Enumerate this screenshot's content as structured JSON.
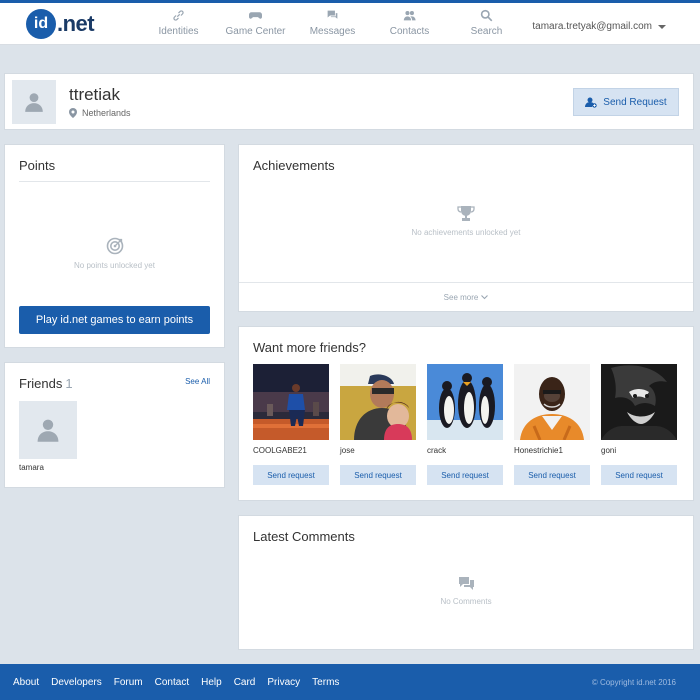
{
  "brand": {
    "logo_mark": "id",
    "logo_text": ".net",
    "color": "#1a5dab"
  },
  "nav": [
    {
      "label": "Identities",
      "icon": "link-icon"
    },
    {
      "label": "Game Center",
      "icon": "gamepad-icon"
    },
    {
      "label": "Messages",
      "icon": "chat-icon"
    },
    {
      "label": "Contacts",
      "icon": "users-icon"
    },
    {
      "label": "Search",
      "icon": "search-icon"
    }
  ],
  "user": {
    "email": "tamara.tretyak@gmail.com"
  },
  "profile": {
    "name": "ttretiak",
    "location": "Netherlands",
    "send_request_label": "Send Request"
  },
  "points": {
    "title": "Points",
    "empty_text": "No points unlocked yet",
    "play_button": "Play id.net games to earn points"
  },
  "friends": {
    "title": "Friends",
    "count": "1",
    "see_all": "See All",
    "items": [
      {
        "name": "tamara"
      }
    ]
  },
  "achievements": {
    "title": "Achievements",
    "empty_text": "No achievements unlocked yet",
    "see_more": "See more"
  },
  "want_more": {
    "title": "Want more friends?",
    "people": [
      {
        "name": "COOLGABE21",
        "button": "Send request"
      },
      {
        "name": "jose",
        "button": "Send request"
      },
      {
        "name": "crack",
        "button": "Send request"
      },
      {
        "name": "Honestrichie1",
        "button": "Send request"
      },
      {
        "name": "goni",
        "button": "Send request"
      }
    ]
  },
  "comments": {
    "title": "Latest Comments",
    "empty_text": "No Comments"
  },
  "footer": {
    "links": [
      "About",
      "Developers",
      "Forum",
      "Contact",
      "Help",
      "Card",
      "Privacy",
      "Terms"
    ],
    "copyright": "© Copyright id.net 2016"
  }
}
